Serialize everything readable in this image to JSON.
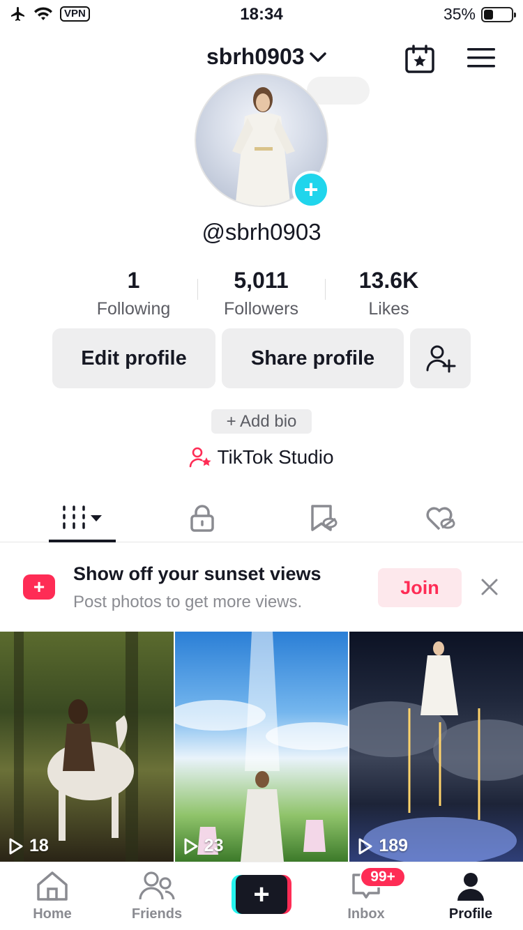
{
  "status_bar": {
    "time": "18:34",
    "vpn": "VPN",
    "battery_pct": "35%",
    "battery_level": 0.35
  },
  "header": {
    "username": "sbrh0903"
  },
  "profile": {
    "handle": "@sbrh0903",
    "stats": [
      {
        "value": "1",
        "label": "Following"
      },
      {
        "value": "5,011",
        "label": "Followers"
      },
      {
        "value": "13.6K",
        "label": "Likes"
      }
    ],
    "edit_label": "Edit profile",
    "share_label": "Share profile",
    "add_bio_label": "+ Add bio",
    "studio_label": "TikTok Studio"
  },
  "tabs": [
    "videos-grid",
    "private-lock",
    "reposts",
    "liked"
  ],
  "promo": {
    "title": "Show off your sunset views",
    "subtitle": "Post photos to get more views.",
    "join_label": "Join"
  },
  "videos": [
    {
      "views": "18"
    },
    {
      "views": "23"
    },
    {
      "views": "189"
    }
  ],
  "nav": {
    "home": "Home",
    "friends": "Friends",
    "inbox": "Inbox",
    "inbox_badge": "99+",
    "profile": "Profile"
  },
  "colors": {
    "accent": "#fe2c55",
    "cyan": "#20d5ec",
    "text": "#161823",
    "muted": "#8a8b91"
  }
}
